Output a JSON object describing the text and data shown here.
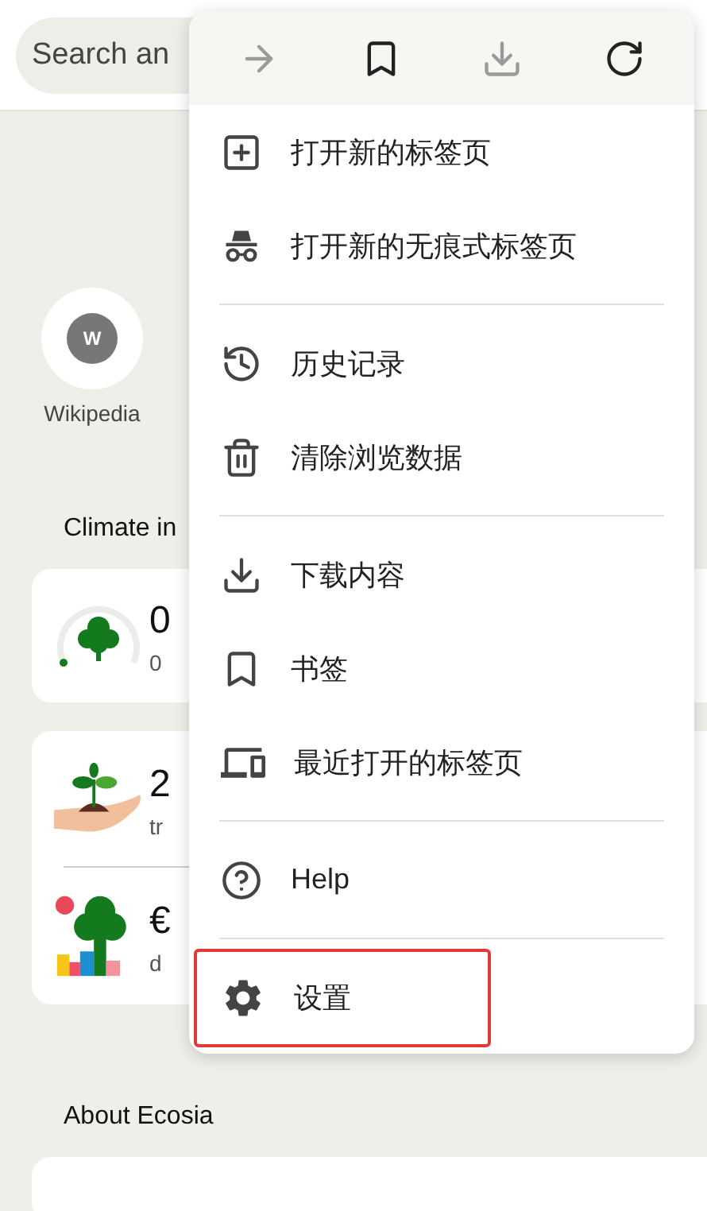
{
  "search": {
    "placeholder": "Search an"
  },
  "shortcuts": [
    {
      "letter": "W",
      "label": "Wikipedia"
    }
  ],
  "climate": {
    "heading": "Climate in",
    "cards": [
      {
        "rows": [
          {
            "kind": "gauge",
            "value": "0",
            "caption": "0"
          }
        ]
      },
      {
        "rows": [
          {
            "kind": "plant",
            "value": "2",
            "caption": "tr"
          },
          {
            "kind": "money",
            "value": "€",
            "caption": "d"
          }
        ]
      }
    ]
  },
  "about": {
    "heading": "About Ecosia"
  },
  "menu": {
    "toolbar": [
      {
        "kind": "forward",
        "disabled": true
      },
      {
        "kind": "bookmark",
        "disabled": false
      },
      {
        "kind": "download",
        "disabled": true
      },
      {
        "kind": "reload",
        "disabled": false
      }
    ],
    "sections": [
      [
        {
          "kind": "new-tab",
          "label": "打开新的标签页",
          "highlighted": false
        },
        {
          "kind": "incognito",
          "label": "打开新的无痕式标签页",
          "highlighted": false
        }
      ],
      [
        {
          "kind": "history",
          "label": "历史记录",
          "highlighted": false
        },
        {
          "kind": "trash",
          "label": "清除浏览数据",
          "highlighted": false
        }
      ],
      [
        {
          "kind": "download",
          "label": "下载内容",
          "highlighted": false
        },
        {
          "kind": "bookmark",
          "label": "书签",
          "highlighted": false
        },
        {
          "kind": "devices",
          "label": "最近打开的标签页",
          "highlighted": false
        }
      ],
      [
        {
          "kind": "help",
          "label": "Help",
          "highlighted": false
        }
      ],
      [
        {
          "kind": "settings",
          "label": "设置",
          "highlighted": true
        }
      ]
    ]
  }
}
